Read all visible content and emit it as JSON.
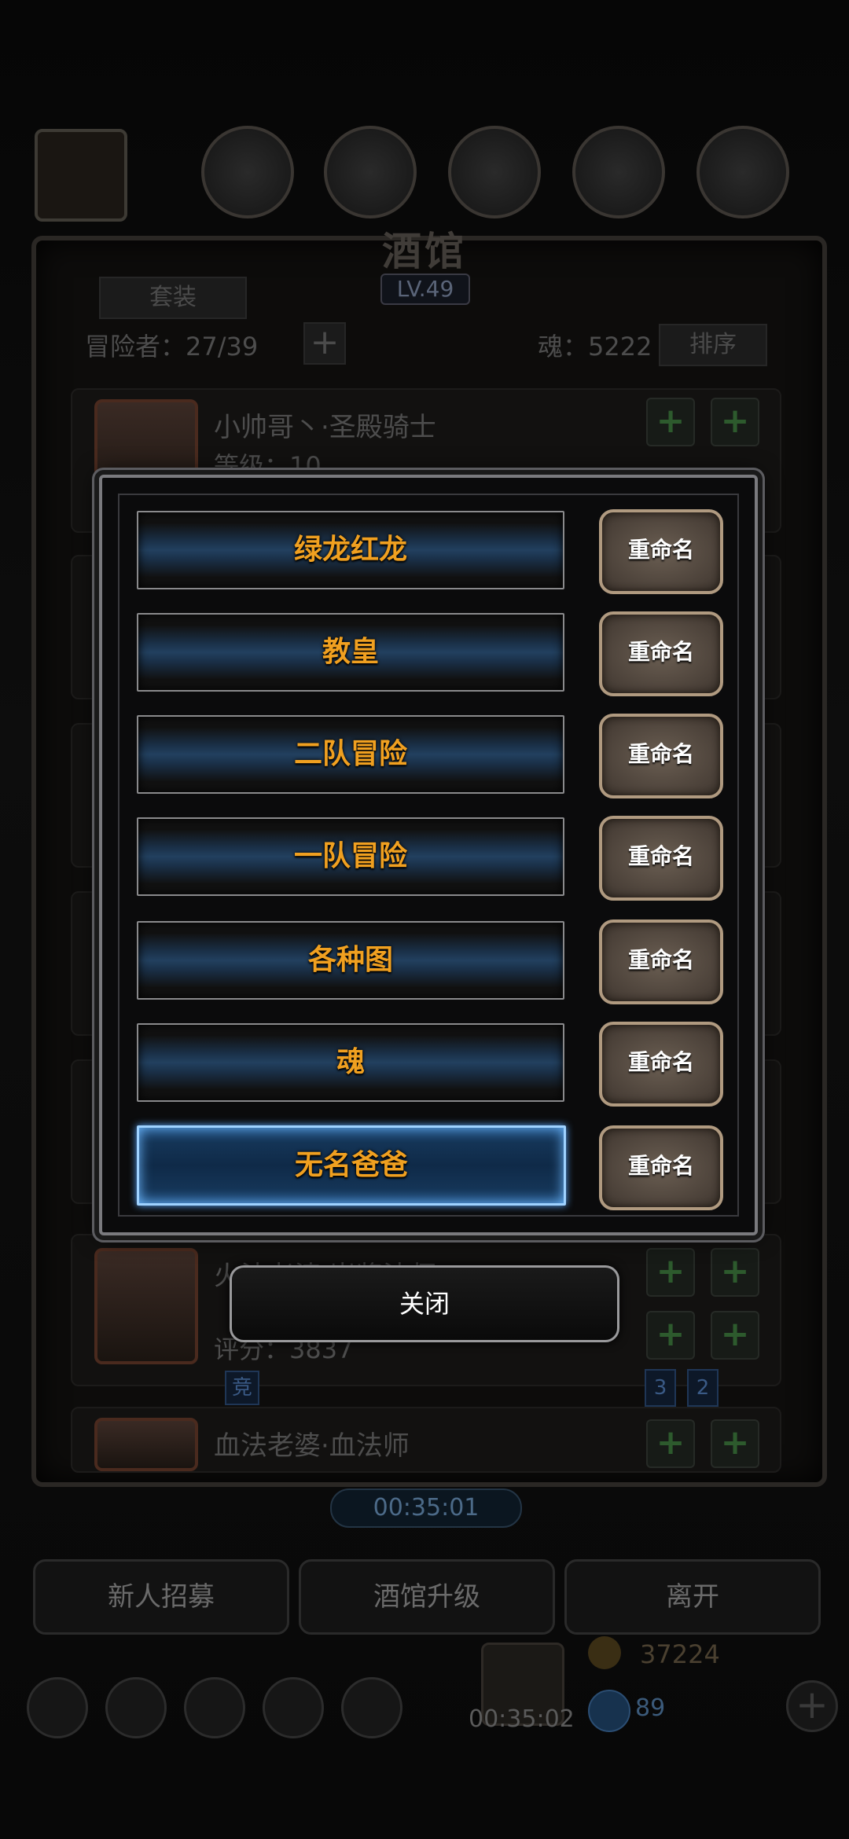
{
  "header": {
    "title": "酒馆",
    "level": "LV.49",
    "outfit_button": "套装",
    "adventurers_label": "冒险者：27/39",
    "souls_label": "魂：5222",
    "sort_button": "排序"
  },
  "heroes": [
    {
      "name": "小帅哥丶·圣殿骑士",
      "sub": "等级：10"
    },
    {
      "name": "火法老婆·岩浆法师",
      "sub": "评分：3837",
      "tag": "竞",
      "badges": [
        "3",
        "2"
      ]
    },
    {
      "name": "血法老婆·血法师"
    }
  ],
  "dialog": {
    "slots": [
      {
        "label": "绿龙红龙",
        "rename": "重命名"
      },
      {
        "label": "教皇",
        "rename": "重命名"
      },
      {
        "label": "二队冒险",
        "rename": "重命名"
      },
      {
        "label": "一队冒险",
        "rename": "重命名"
      },
      {
        "label": "各种图",
        "rename": "重命名"
      },
      {
        "label": "魂",
        "rename": "重命名"
      },
      {
        "label": "无名爸爸",
        "rename": "重命名",
        "selected": true
      }
    ],
    "close_label": "关闭"
  },
  "footer": {
    "timer": "00:35:01",
    "buttons": [
      "新人招募",
      "酒馆升级",
      "离开"
    ],
    "gold": "37224",
    "gem_count": "89",
    "bottom_timer": "00:35:02"
  },
  "colors": {
    "slot_text": "#f0a020",
    "selected_glow": "#9fd2ff",
    "rename_border": "#b09a80"
  }
}
